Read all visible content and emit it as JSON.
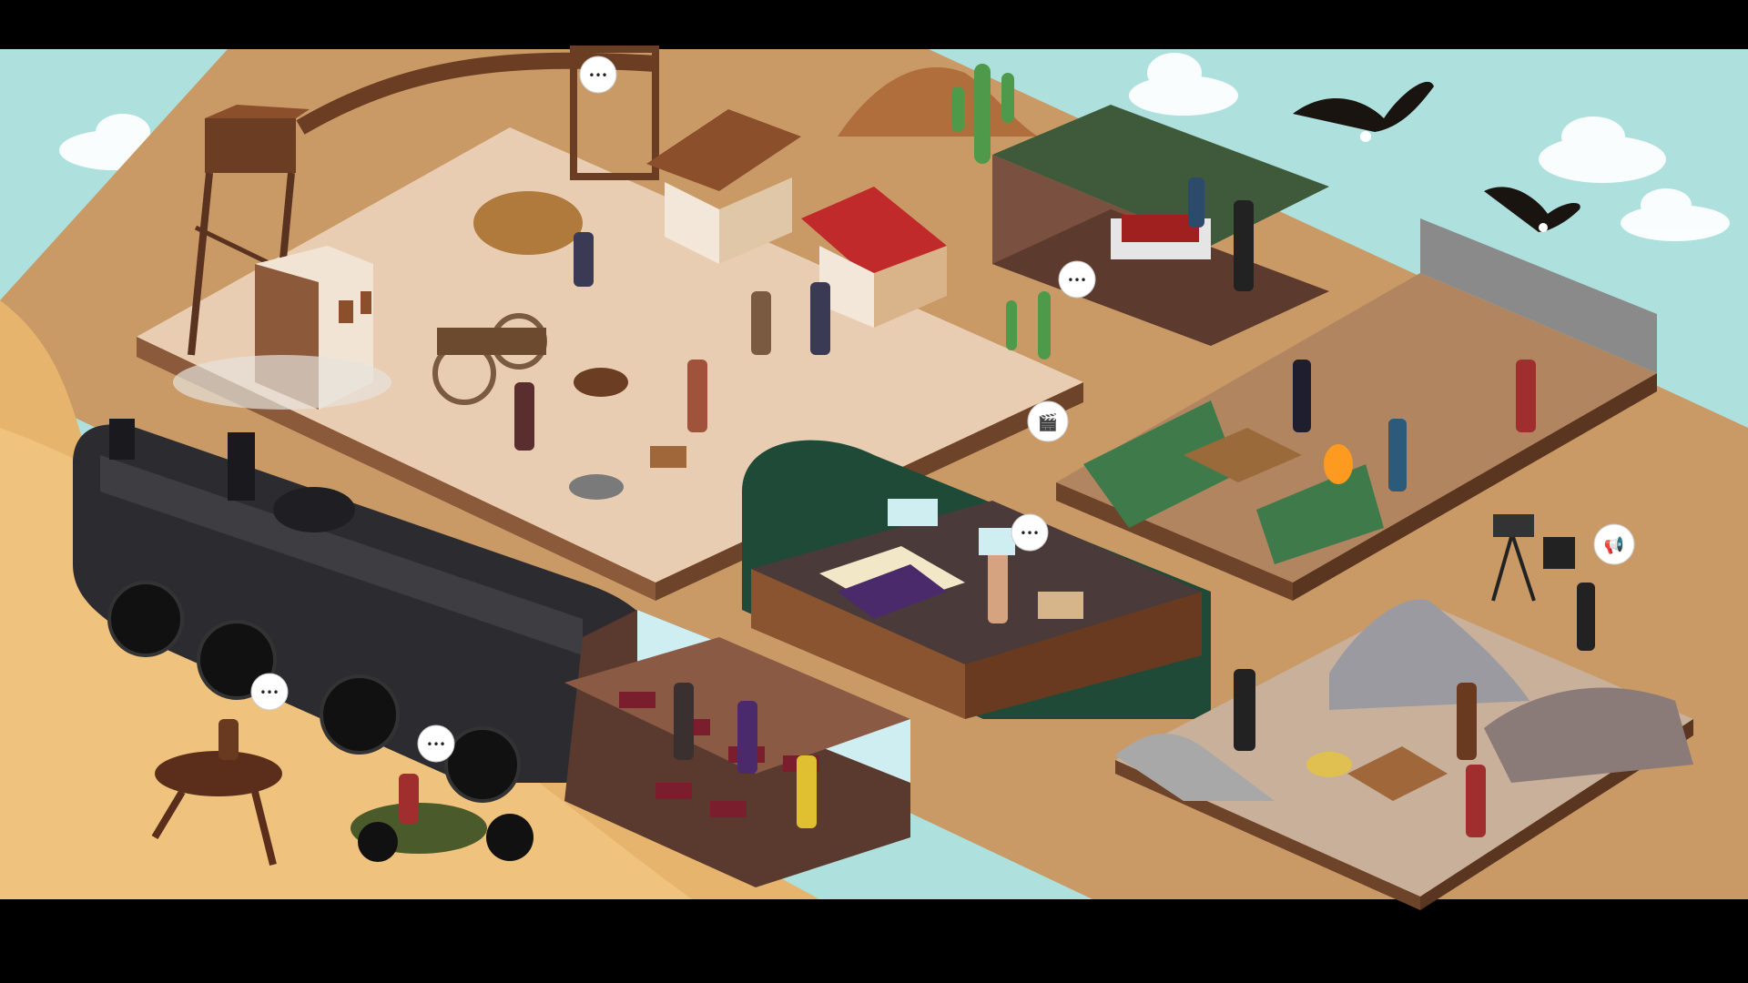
{
  "scene": {
    "sky_color": "#aee0dd",
    "ground_color": "#cfa06b",
    "sand_color": "#e8b66a",
    "letterbox_color": "#000000"
  },
  "bubbles": [
    {
      "id": "bridge-worker-bubble",
      "icon": "ellipsis-icon",
      "glyph": "•••"
    },
    {
      "id": "saloon-bubble",
      "icon": "ellipsis-icon",
      "glyph": "•••"
    },
    {
      "id": "clapper-bubble",
      "icon": "clapperboard-icon",
      "glyph": "🎬"
    },
    {
      "id": "train-car-bubble",
      "icon": "ellipsis-icon",
      "glyph": "•••"
    },
    {
      "id": "director-bubble",
      "icon": "megaphone-icon",
      "glyph": "📢"
    },
    {
      "id": "rider-bubble",
      "icon": "ellipsis-icon",
      "glyph": "•••"
    },
    {
      "id": "motorcycle-bubble",
      "icon": "ellipsis-icon",
      "glyph": "•••"
    }
  ]
}
